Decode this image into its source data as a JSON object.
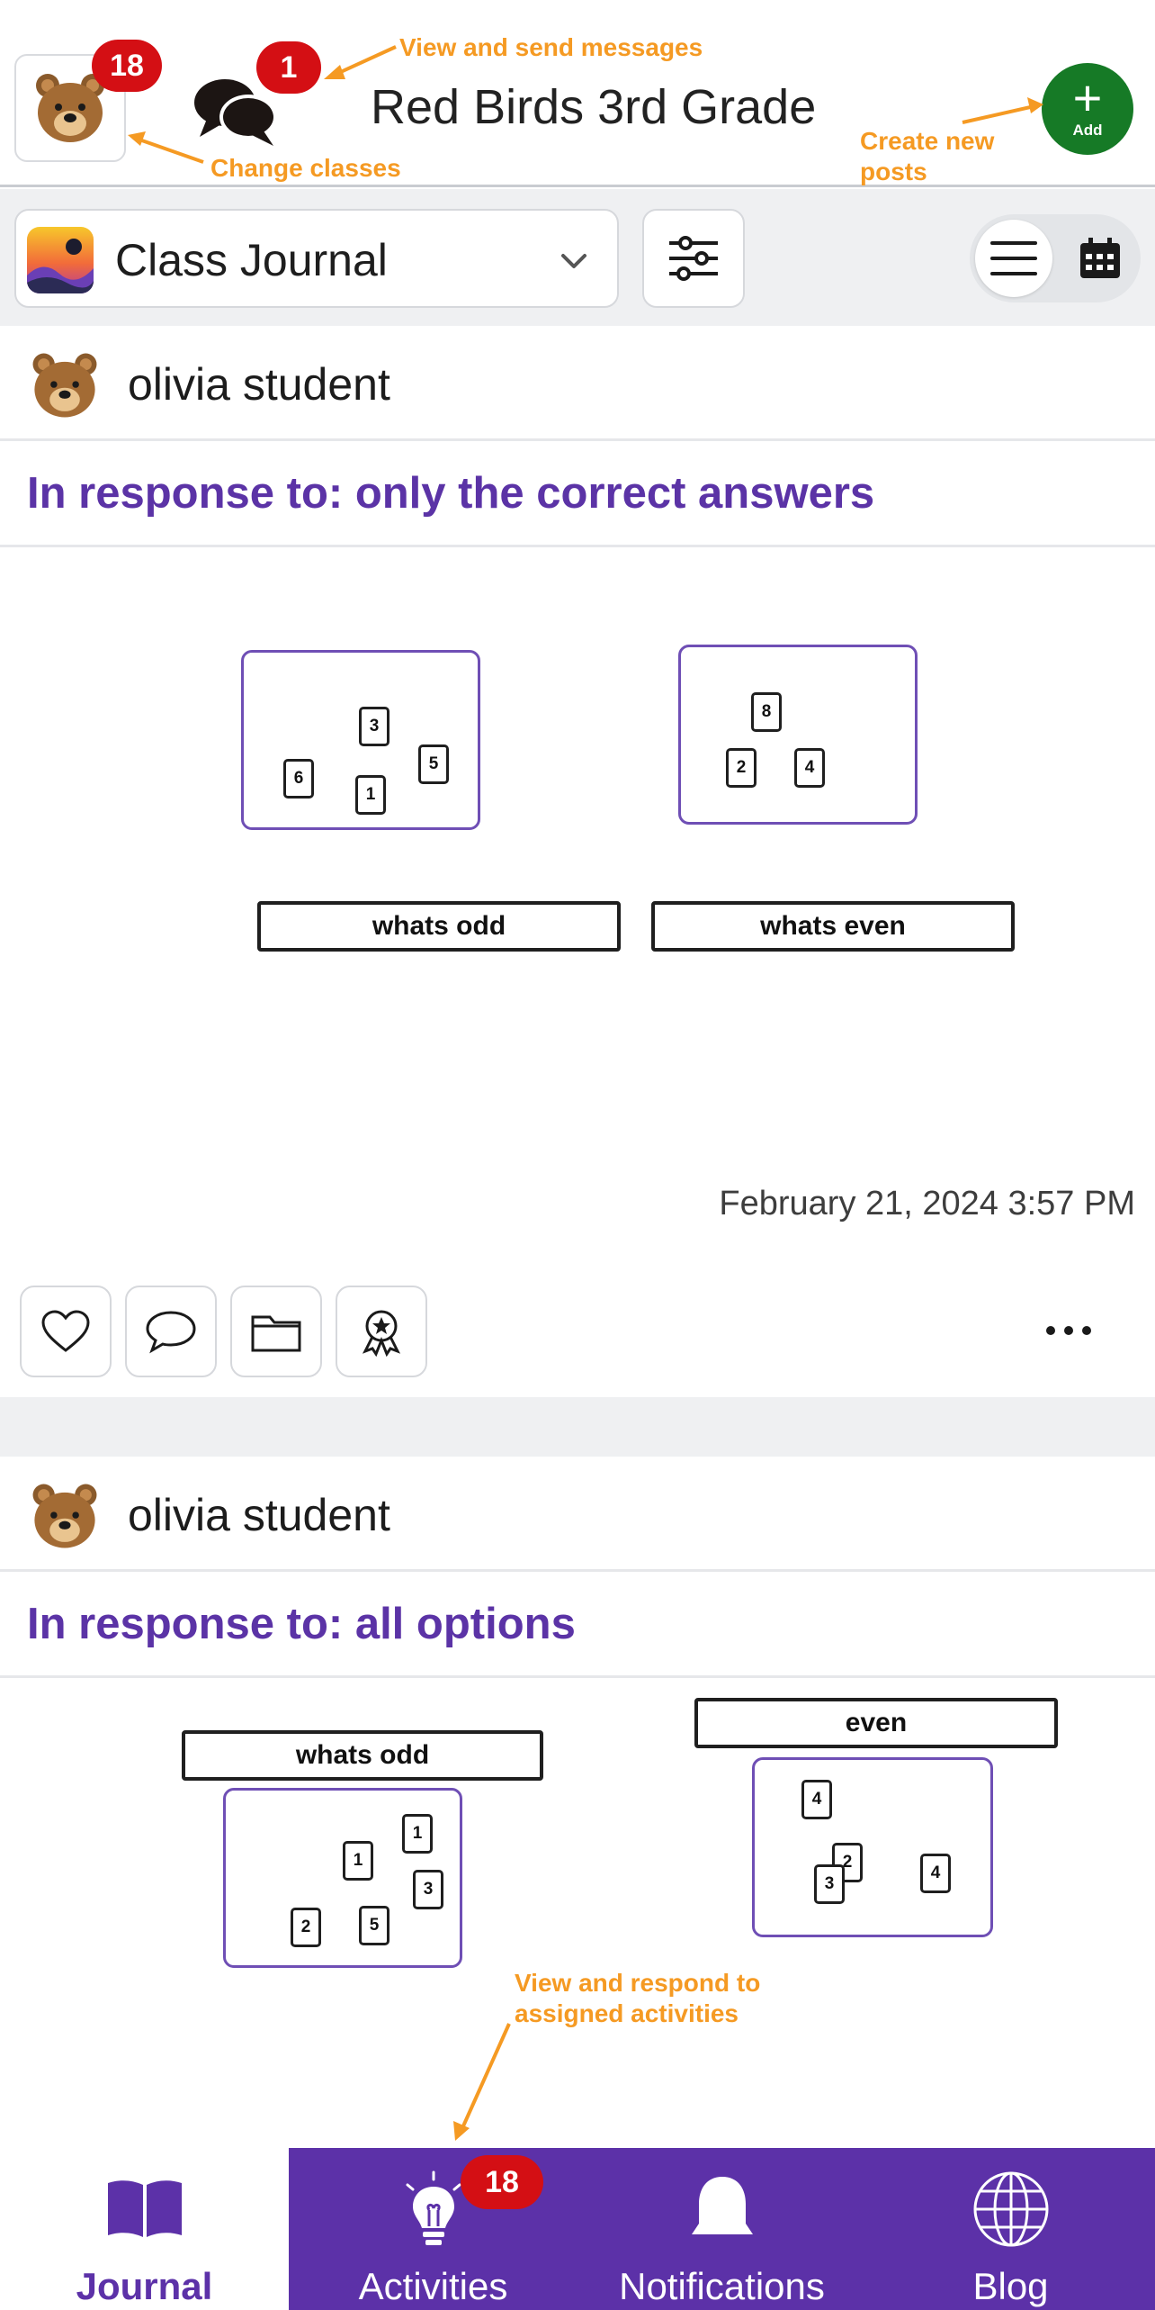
{
  "header": {
    "class_badge": "18",
    "messages_badge": "1",
    "class_title": "Red Birds 3rd Grade",
    "add_label": "Add",
    "colors": {
      "add_button": "#167a26",
      "badge": "#d40f14"
    }
  },
  "callouts": {
    "messages": "View and send messages",
    "classes": "Change classes",
    "create_line1": "Create new",
    "create_line2": "posts",
    "activities_line1": "View and respond to",
    "activities_line2": "assigned activities"
  },
  "toolbar": {
    "journal_label": "Class Journal",
    "icons": [
      "filter-sliders-icon",
      "list-view-icon",
      "calendar-view-icon"
    ]
  },
  "posts": [
    {
      "author": "olivia student",
      "response": "In response to: only the correct answers",
      "timestamp": "February 21, 2024 3:57 PM",
      "groups": [
        {
          "label": "whats odd",
          "cards": [
            "3",
            "5",
            "6",
            "1"
          ]
        },
        {
          "label": "whats even",
          "cards": [
            "8",
            "2",
            "4"
          ]
        }
      ]
    },
    {
      "author": "olivia student",
      "response": "In response to: all options",
      "groups": [
        {
          "label": "whats odd",
          "cards": [
            "1",
            "1",
            "3",
            "2",
            "5"
          ]
        },
        {
          "label": "even",
          "cards": [
            "4",
            "2",
            "3",
            "4"
          ]
        }
      ]
    }
  ],
  "bottom_nav": {
    "items": [
      {
        "label": "Journal",
        "icon": "book-icon"
      },
      {
        "label": "Activities",
        "icon": "lightbulb-icon"
      },
      {
        "label": "Notifications",
        "icon": "bell-icon"
      },
      {
        "label": "Blog",
        "icon": "globe-icon"
      }
    ],
    "activities_badge": "18",
    "colors": {
      "nav_background": "#5c31a8",
      "accent_text": "#5b33a6",
      "callout": "#f59a23"
    }
  }
}
